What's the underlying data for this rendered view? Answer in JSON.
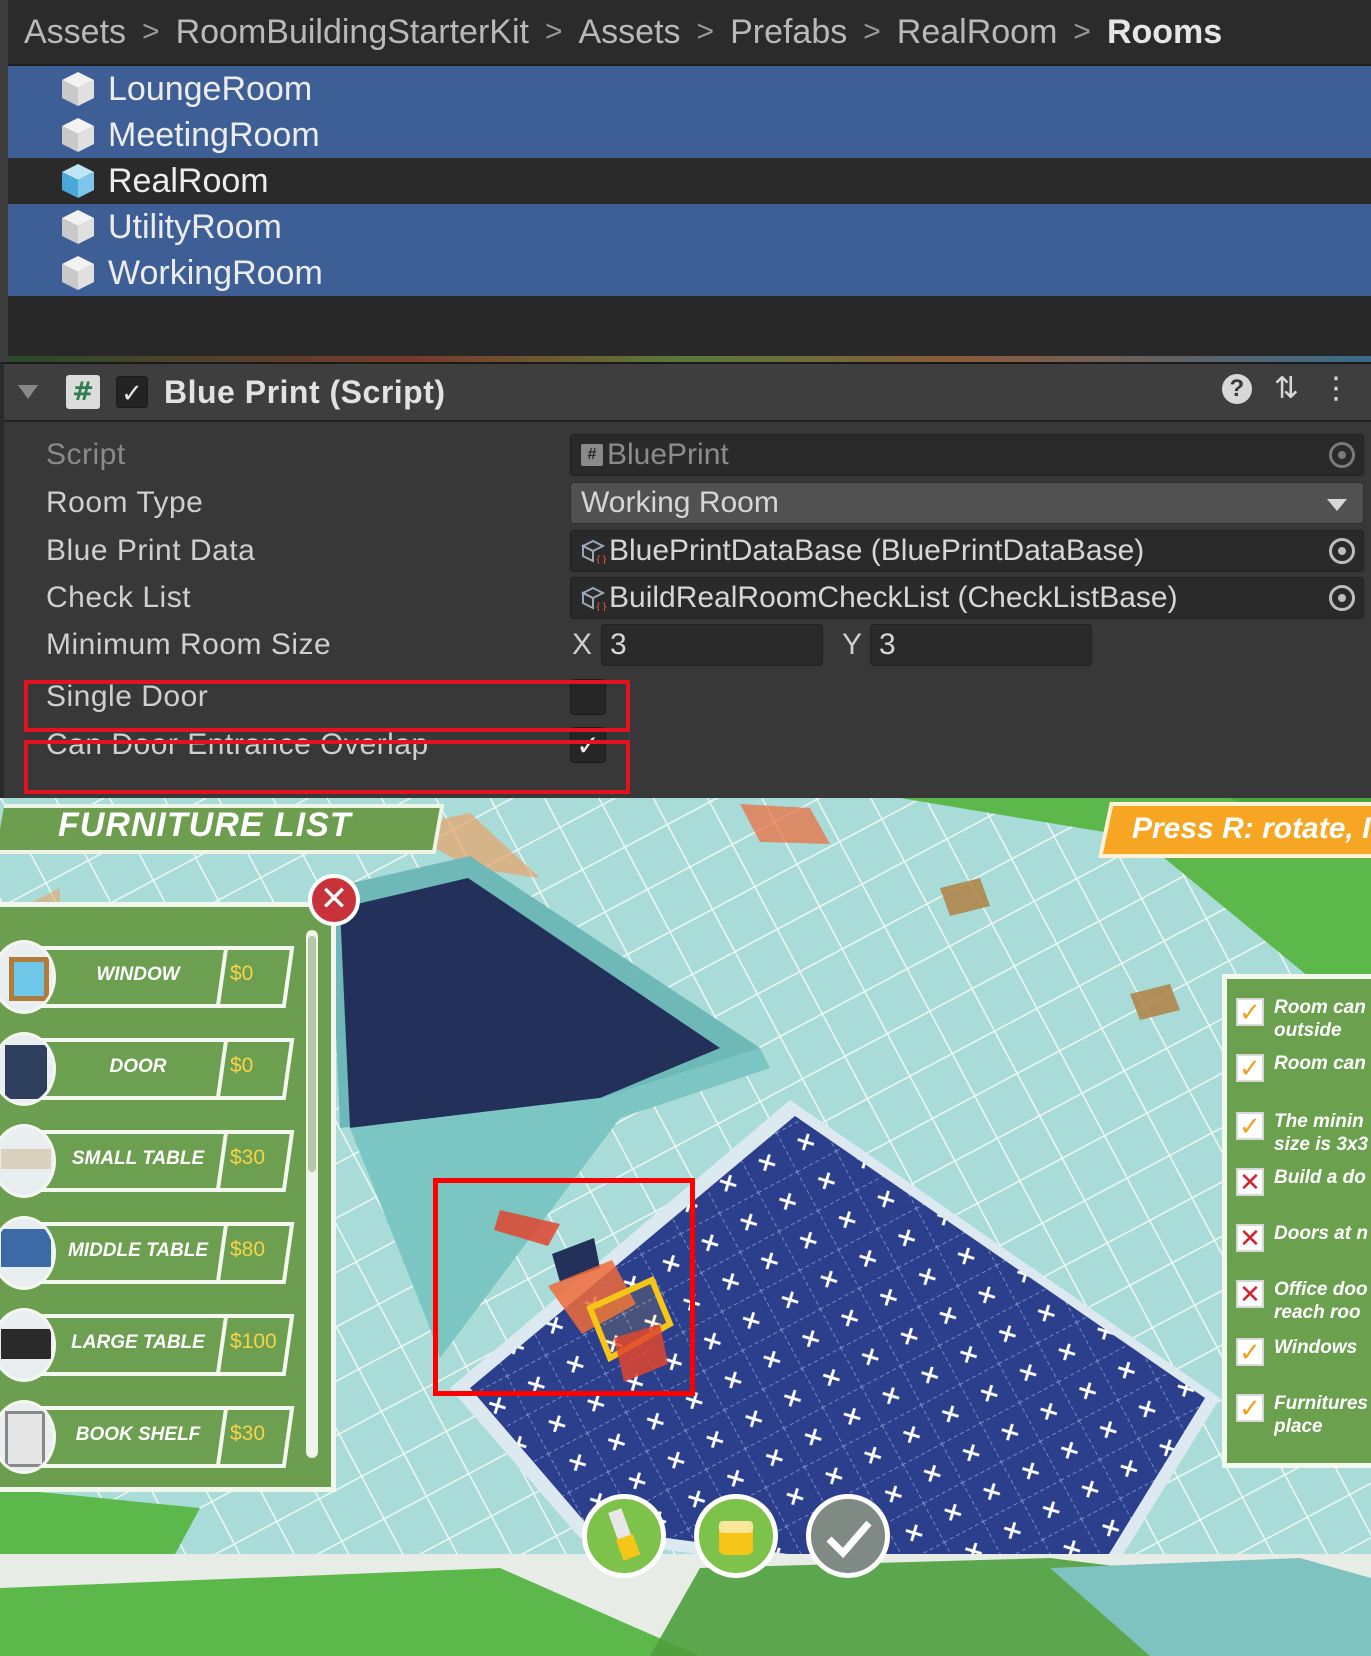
{
  "project": {
    "breadcrumb": [
      "Assets",
      "RoomBuildingStarterKit",
      "Assets",
      "Prefabs",
      "RealRoom",
      "Rooms"
    ],
    "files": [
      {
        "name": "LoungeRoom",
        "selected": true
      },
      {
        "name": "MeetingRoom",
        "selected": true
      },
      {
        "name": "RealRoom",
        "selected": false
      },
      {
        "name": "UtilityRoom",
        "selected": true
      },
      {
        "name": "WorkingRoom",
        "selected": true
      }
    ]
  },
  "inspector": {
    "component_title": "Blue Print (Script)",
    "component_enabled": true,
    "script_label": "Script",
    "script_value": "BluePrint",
    "room_type_label": "Room Type",
    "room_type_value": "Working Room",
    "blue_print_data_label": "Blue Print Data",
    "blue_print_data_value": "BluePrintDataBase (BluePrintDataBase)",
    "check_list_label": "Check List",
    "check_list_value": "BuildRealRoomCheckList (CheckListBase)",
    "min_room_size_label": "Minimum Room Size",
    "x_label": "X",
    "x_value": "3",
    "y_label": "Y",
    "y_value": "3",
    "single_door_label": "Single Door",
    "single_door_checked": false,
    "overlap_label": "Can Door Entrance Overlap",
    "overlap_checked": true,
    "checkmark": "✓"
  },
  "game": {
    "furniture_title": "FURNITURE LIST",
    "press_hint": "Press R: rotate, I",
    "close_glyph": "✕",
    "furniture": [
      {
        "name": "WINDOW",
        "price": "$0",
        "thumb_color": "#6ec7e8"
      },
      {
        "name": "DOOR",
        "price": "$0",
        "thumb_color": "#2f3f5e"
      },
      {
        "name": "SMALL TABLE",
        "price": "$30",
        "thumb_color": "#d9d0bd"
      },
      {
        "name": "MIDDLE TABLE",
        "price": "$80",
        "thumb_color": "#3c6aa6"
      },
      {
        "name": "LARGE TABLE",
        "price": "$100",
        "thumb_color": "#2a2a2a"
      },
      {
        "name": "BOOK SHELF",
        "price": "$30",
        "thumb_color": "#e6e6e6"
      }
    ],
    "checklist": [
      {
        "text": "Room can\noutside",
        "ok": true
      },
      {
        "text": "Room can",
        "ok": true
      },
      {
        "text": "The minin\nsize is 3x3",
        "ok": true
      },
      {
        "text": "Build a do",
        "ok": false
      },
      {
        "text": "Doors at n",
        "ok": false
      },
      {
        "text": "Office doo\nreach roo",
        "ok": false
      },
      {
        "text": "Windows",
        "ok": true
      },
      {
        "text": "Furnitures\nplace",
        "ok": true
      }
    ],
    "ok_glyph": "✓",
    "bad_glyph": "✕",
    "colors": {
      "grass": "#5cb84a",
      "floor": "#a9dcd8",
      "blueprint": "#2b3f8c",
      "wall_dark": "#22305a",
      "panel_green": "#6b9e4e",
      "accent_orange": "#f6a623"
    }
  }
}
